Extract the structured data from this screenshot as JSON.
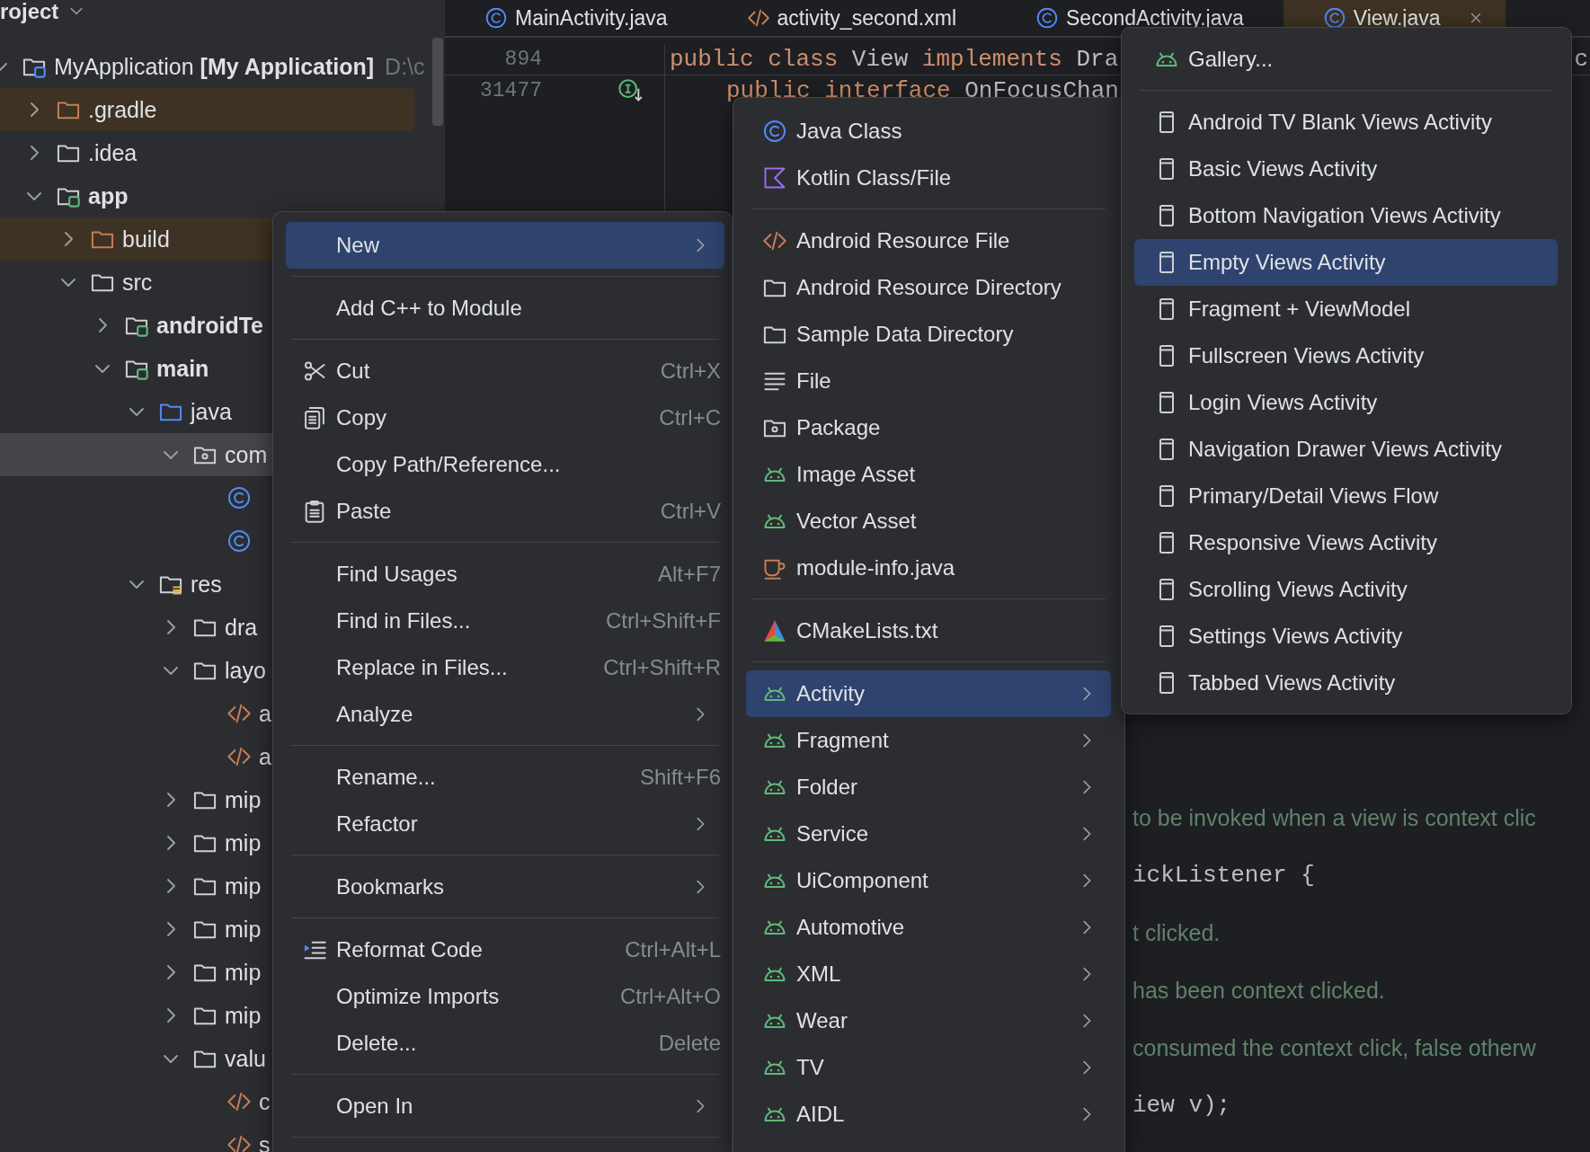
{
  "project_panel": {
    "title": "roject",
    "tree": [
      {
        "label": "MyApplication **[My Application]**",
        "path": "D:\\c",
        "kind": "project",
        "expanded": true,
        "selected": false,
        "children": [
          {
            "label": ".gradle",
            "kind": "excluded",
            "expanded": false,
            "selected": false
          },
          {
            "label": ".idea",
            "kind": "folder",
            "expanded": false,
            "selected": false
          },
          {
            "label": "app",
            "kind": "module",
            "expanded": true,
            "selected": false,
            "children": [
              {
                "label": "build",
                "kind": "excluded",
                "expanded": false,
                "selected": false
              },
              {
                "label": "src",
                "kind": "folder",
                "expanded": true,
                "selected": false,
                "children": [
                  {
                    "label": "androidTe",
                    "kind": "module",
                    "expanded": false,
                    "selected": false
                  },
                  {
                    "label": "main",
                    "kind": "module",
                    "expanded": true,
                    "selected": false,
                    "children": [
                      {
                        "label": "java",
                        "kind": "source",
                        "expanded": true,
                        "selected": false,
                        "children": [
                          {
                            "label": "com",
                            "kind": "package",
                            "expanded": true,
                            "selected": true,
                            "children": [
                              {
                                "kind": "class",
                                "selected": false
                              },
                              {
                                "kind": "class",
                                "selected": false
                              }
                            ]
                          }
                        ]
                      },
                      {
                        "label": "res",
                        "kind": "res",
                        "expanded": true,
                        "selected": false,
                        "children": [
                          {
                            "label": "dra",
                            "kind": "folder",
                            "expanded": false,
                            "selected": false
                          },
                          {
                            "label": "layo",
                            "kind": "folder",
                            "expanded": true,
                            "selected": false,
                            "children": [
                              {
                                "label": "a",
                                "kind": "xml",
                                "selected": false
                              },
                              {
                                "label": "a",
                                "kind": "xml",
                                "selected": false
                              }
                            ]
                          },
                          {
                            "label": "mip",
                            "kind": "folder",
                            "expanded": false,
                            "selected": false
                          },
                          {
                            "label": "mip",
                            "kind": "folder",
                            "expanded": false,
                            "selected": false
                          },
                          {
                            "label": "mip",
                            "kind": "folder",
                            "expanded": false,
                            "selected": false
                          },
                          {
                            "label": "mip",
                            "kind": "folder",
                            "expanded": false,
                            "selected": false
                          },
                          {
                            "label": "mip",
                            "kind": "folder",
                            "expanded": false,
                            "selected": false
                          },
                          {
                            "label": "mip",
                            "kind": "folder",
                            "expanded": false,
                            "selected": false
                          },
                          {
                            "label": "valu",
                            "kind": "folder",
                            "expanded": true,
                            "selected": false,
                            "children": [
                              {
                                "label": "c",
                                "kind": "xml",
                                "selected": false
                              },
                              {
                                "label": "s",
                                "kind": "xml",
                                "selected": false
                              }
                            ]
                          }
                        ]
                      }
                    ]
                  }
                ]
              }
            ]
          }
        ]
      }
    ]
  },
  "editor": {
    "tabs": [
      {
        "label": "MainActivity.java",
        "kind": "class",
        "selected": false
      },
      {
        "label": "activity_second.xml",
        "kind": "xml",
        "selected": false
      },
      {
        "label": "SecondActivity.java",
        "kind": "class",
        "selected": false
      },
      {
        "label": "View.java",
        "kind": "class",
        "selected": true
      }
    ],
    "lines": [
      {
        "number": "894",
        "gutter_mark": false,
        "indented": false,
        "tokens": [
          {
            "kind": "keyword",
            "text": "public class "
          },
          {
            "kind": "plain",
            "text": "View "
          },
          {
            "kind": "keyword",
            "text": "implements "
          },
          {
            "kind": "plain",
            "text": "Dra"
          }
        ],
        "tail": "c"
      },
      {
        "number": "31477",
        "gutter_mark": true,
        "indented": true,
        "tokens": [
          {
            "kind": "keyword",
            "text": "public interface "
          },
          {
            "kind": "plain",
            "text": "OnFocusChan"
          }
        ]
      }
    ],
    "fragments": [
      {
        "kind": "comment",
        "text": "to be invoked when a view is context clic"
      },
      {
        "kind": "code",
        "text": "ickListener {"
      },
      {
        "kind": "comment",
        "text": "t clicked."
      },
      {
        "kind": "comment",
        "text": "has been context clicked."
      },
      {
        "kind": "comment",
        "text": "consumed the context click, false otherw"
      },
      {
        "kind": "code",
        "text": "iew v);"
      }
    ]
  },
  "context_menu": {
    "items": [
      {
        "kind": "plain",
        "label": "New",
        "has_submenu": true,
        "selected": true
      },
      {
        "kind": "separator"
      },
      {
        "kind": "plain",
        "label": "Add C++ to Module",
        "has_submenu": false,
        "selected": false
      },
      {
        "kind": "separator"
      },
      {
        "kind": "cut",
        "label": "Cut",
        "shortcut": "Ctrl+X",
        "has_submenu": false,
        "selected": false
      },
      {
        "kind": "copy",
        "label": "Copy",
        "shortcut": "Ctrl+C",
        "has_submenu": false,
        "selected": false
      },
      {
        "kind": "plain",
        "label": "Copy Path/Reference...",
        "has_submenu": false,
        "selected": false
      },
      {
        "kind": "paste",
        "label": "Paste",
        "shortcut": "Ctrl+V",
        "has_submenu": false,
        "selected": false
      },
      {
        "kind": "separator"
      },
      {
        "kind": "plain",
        "label": "Find Usages",
        "shortcut": "Alt+F7",
        "has_submenu": false,
        "selected": false
      },
      {
        "kind": "plain",
        "label": "Find in Files...",
        "shortcut": "Ctrl+Shift+F",
        "has_submenu": false,
        "selected": false
      },
      {
        "kind": "plain",
        "label": "Replace in Files...",
        "shortcut": "Ctrl+Shift+R",
        "has_submenu": false,
        "selected": false
      },
      {
        "kind": "plain",
        "label": "Analyze",
        "has_submenu": true,
        "selected": false
      },
      {
        "kind": "separator"
      },
      {
        "kind": "plain",
        "label": "Rename...",
        "shortcut": "Shift+F6",
        "has_submenu": false,
        "selected": false
      },
      {
        "kind": "plain",
        "label": "Refactor",
        "has_submenu": true,
        "selected": false
      },
      {
        "kind": "separator"
      },
      {
        "kind": "plain",
        "label": "Bookmarks",
        "has_submenu": true,
        "selected": false
      },
      {
        "kind": "separator"
      },
      {
        "kind": "reformat",
        "label": "Reformat Code",
        "shortcut": "Ctrl+Alt+L",
        "has_submenu": false,
        "selected": false
      },
      {
        "kind": "plain",
        "label": "Optimize Imports",
        "shortcut": "Ctrl+Alt+O",
        "has_submenu": false,
        "selected": false
      },
      {
        "kind": "plain",
        "label": "Delete...",
        "shortcut": "Delete",
        "has_submenu": false,
        "selected": false
      },
      {
        "kind": "separator"
      },
      {
        "kind": "plain",
        "label": "Open In",
        "has_submenu": true,
        "selected": false
      },
      {
        "kind": "separator"
      }
    ]
  },
  "new_submenu": {
    "items": [
      {
        "kind": "class",
        "label": "Java Class",
        "has_submenu": false,
        "selected": false
      },
      {
        "kind": "kotlin",
        "label": "Kotlin Class/File",
        "has_submenu": false,
        "selected": false
      },
      {
        "kind": "separator"
      },
      {
        "kind": "xml",
        "label": "Android Resource File",
        "has_submenu": false,
        "selected": false
      },
      {
        "kind": "folder",
        "label": "Android Resource Directory",
        "has_submenu": false,
        "selected": false
      },
      {
        "kind": "folder",
        "label": "Sample Data Directory",
        "has_submenu": false,
        "selected": false
      },
      {
        "kind": "file",
        "label": "File",
        "has_submenu": false,
        "selected": false
      },
      {
        "kind": "package",
        "label": "Package",
        "has_submenu": false,
        "selected": false
      },
      {
        "kind": "android",
        "label": "Image Asset",
        "has_submenu": false,
        "selected": false
      },
      {
        "kind": "android",
        "label": "Vector Asset",
        "has_submenu": false,
        "selected": false
      },
      {
        "kind": "cup",
        "label": "module-info.java",
        "has_submenu": false,
        "selected": false
      },
      {
        "kind": "separator"
      },
      {
        "kind": "cmake",
        "label": "CMakeLists.txt",
        "has_submenu": false,
        "selected": false
      },
      {
        "kind": "separator"
      },
      {
        "kind": "android",
        "label": "Activity",
        "has_submenu": true,
        "selected": true
      },
      {
        "kind": "android",
        "label": "Fragment",
        "has_submenu": true,
        "selected": false
      },
      {
        "kind": "android",
        "label": "Folder",
        "has_submenu": true,
        "selected": false
      },
      {
        "kind": "android",
        "label": "Service",
        "has_submenu": true,
        "selected": false
      },
      {
        "kind": "android",
        "label": "UiComponent",
        "has_submenu": true,
        "selected": false
      },
      {
        "kind": "android",
        "label": "Automotive",
        "has_submenu": true,
        "selected": false
      },
      {
        "kind": "android",
        "label": "XML",
        "has_submenu": true,
        "selected": false
      },
      {
        "kind": "android",
        "label": "Wear",
        "has_submenu": true,
        "selected": false
      },
      {
        "kind": "android",
        "label": "TV",
        "has_submenu": true,
        "selected": false
      },
      {
        "kind": "android",
        "label": "AIDL",
        "has_submenu": true,
        "selected": false
      }
    ]
  },
  "activity_submenu": {
    "items": [
      {
        "kind": "android",
        "label": "Gallery...",
        "has_submenu": false,
        "selected": false
      },
      {
        "kind": "separator"
      },
      {
        "kind": "screen",
        "label": "Android TV Blank Views Activity",
        "has_submenu": false,
        "selected": false
      },
      {
        "kind": "screen",
        "label": "Basic Views Activity",
        "has_submenu": false,
        "selected": false
      },
      {
        "kind": "screen",
        "label": "Bottom Navigation Views Activity",
        "has_submenu": false,
        "selected": false
      },
      {
        "kind": "screen",
        "label": "Empty Views Activity",
        "has_submenu": false,
        "selected": true
      },
      {
        "kind": "screen",
        "label": "Fragment + ViewModel",
        "has_submenu": false,
        "selected": false
      },
      {
        "kind": "screen",
        "label": "Fullscreen Views Activity",
        "has_submenu": false,
        "selected": false
      },
      {
        "kind": "screen",
        "label": "Login Views Activity",
        "has_submenu": false,
        "selected": false
      },
      {
        "kind": "screen",
        "label": "Navigation Drawer Views Activity",
        "has_submenu": false,
        "selected": false
      },
      {
        "kind": "screen",
        "label": "Primary/Detail Views Flow",
        "has_submenu": false,
        "selected": false
      },
      {
        "kind": "screen",
        "label": "Responsive Views Activity",
        "has_submenu": false,
        "selected": false
      },
      {
        "kind": "screen",
        "label": "Scrolling Views Activity",
        "has_submenu": false,
        "selected": false
      },
      {
        "kind": "screen",
        "label": "Settings Views Activity",
        "has_submenu": false,
        "selected": false
      },
      {
        "kind": "screen",
        "label": "Tabbed Views Activity",
        "has_submenu": false,
        "selected": false
      }
    ]
  }
}
